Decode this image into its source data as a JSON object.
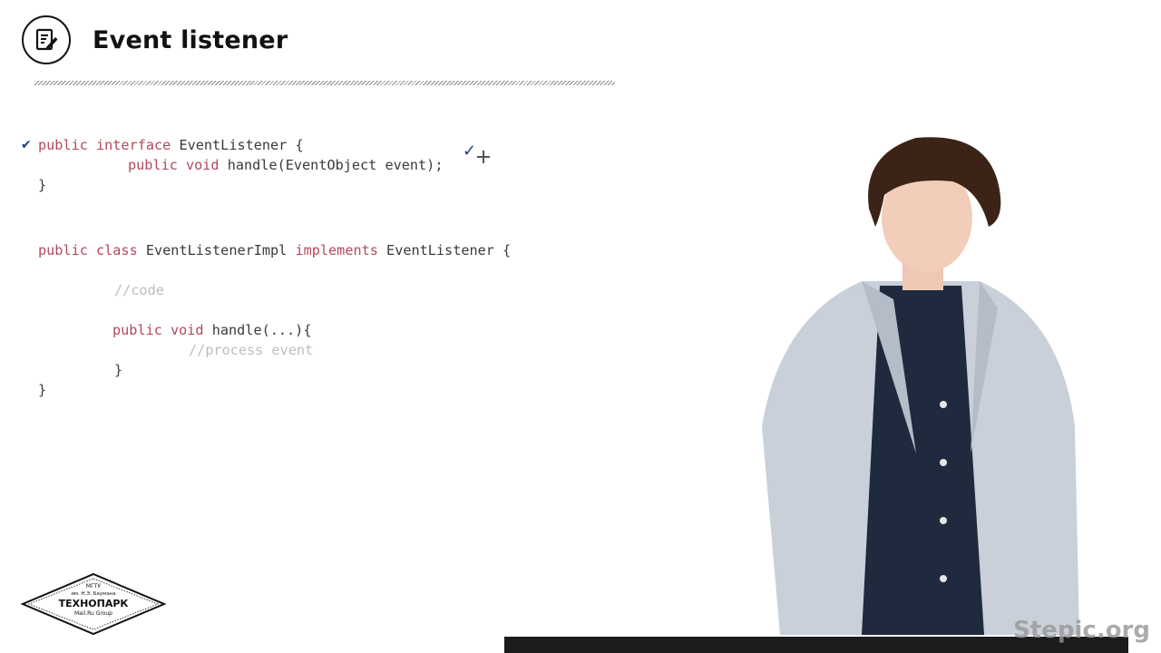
{
  "header": {
    "title": "Event listener",
    "icon": "edit-note-icon"
  },
  "code": {
    "lines": [
      {
        "kw1": "public interface",
        "id1": " EventListener {"
      },
      {
        "kw1": "public void",
        "id1": " handle(EventObject event);"
      },
      {
        "id1": "}"
      },
      {
        "kw1": "public class",
        "id1": " EventListenerImpl ",
        "kw2": "implements",
        "id2": " EventListener {"
      },
      {
        "cm": "//code"
      },
      {
        "kw1": "public void",
        "id1": " handle(...){"
      },
      {
        "cm": "//process event"
      },
      {
        "id1": "}"
      },
      {
        "id1": "}"
      }
    ]
  },
  "annotations": {
    "checkmark": "✔",
    "pen_mark": "✓"
  },
  "logo": {
    "line1": "МГТУ",
    "line2": "им. Н.Э. Баумана",
    "line3": "ТЕХНОПАРК",
    "line4": "Mail.Ru Group"
  },
  "watermark": "Stepic.org",
  "colors": {
    "keyword": "#b2495c",
    "identifier": "#3a3a3a",
    "comment": "#bdbdbd",
    "ink": "#1f3d7a"
  }
}
